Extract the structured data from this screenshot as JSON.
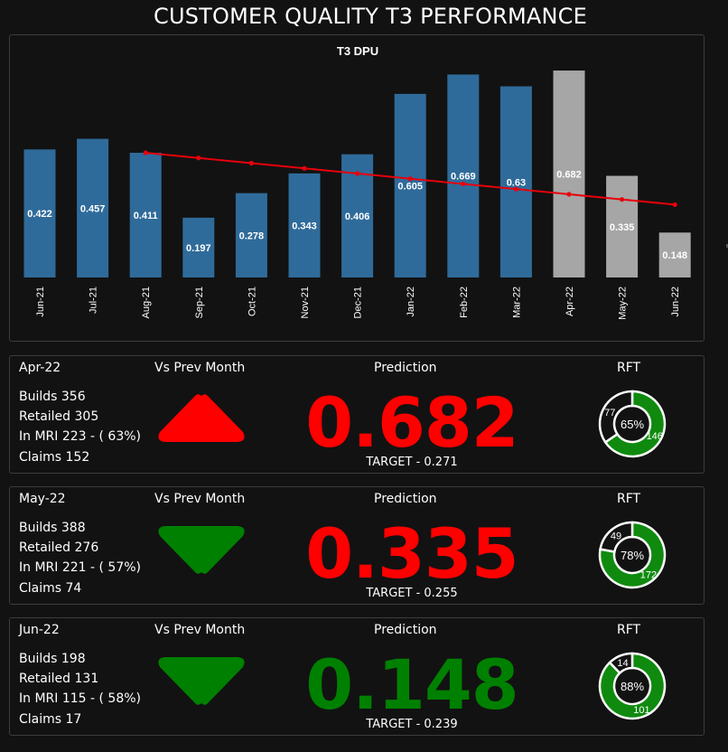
{
  "page": {
    "title": "CUSTOMER QUALITY T3 PERFORMANCE"
  },
  "chart_data": {
    "type": "bar",
    "title": "T3 DPU",
    "categories": [
      "Jun-21",
      "Jul-21",
      "Aug-21",
      "Sep-21",
      "Oct-21",
      "Nov-21",
      "Dec-21",
      "Jan-22",
      "Feb-22",
      "Mar-22",
      "Apr-22",
      "May-22",
      "Jun-22"
    ],
    "values": [
      0.422,
      0.457,
      0.411,
      0.197,
      0.278,
      0.343,
      0.406,
      0.605,
      0.669,
      0.63,
      0.682,
      0.335,
      0.148
    ],
    "value_labels": [
      "0.422",
      "0.457",
      "0.411",
      "0.197",
      "0.278",
      "0.343",
      "0.406",
      "0.605",
      "0.669",
      "0.63",
      "0.682",
      "0.335",
      "0.148"
    ],
    "bar_colors": [
      "#2f6b9a",
      "#2f6b9a",
      "#2f6b9a",
      "#2f6b9a",
      "#2f6b9a",
      "#2f6b9a",
      "#2f6b9a",
      "#2f6b9a",
      "#2f6b9a",
      "#2f6b9a",
      "#a6a6a6",
      "#a6a6a6",
      "#a6a6a6"
    ],
    "trendline": {
      "color": "#e8000b",
      "start_index": 2,
      "end_index": 12,
      "start_value": 0.411,
      "end_value": 0.24
    },
    "ylim": [
      0,
      0.7
    ],
    "xlabel": "",
    "ylabel": "",
    "grid": false,
    "legend": "none"
  },
  "cards": [
    {
      "month": "Apr-22",
      "vs_label": "Vs Prev Month",
      "prediction_label": "Prediction",
      "rft_label": "RFT",
      "builds": "Builds 356",
      "retailed": "Retailed 305",
      "in_mri": "In MRI 223 - ( 63%)",
      "claims": "Claims 152",
      "prediction": "0.682",
      "prediction_color": "#ff0000",
      "target": "TARGET - 0.271",
      "arrow": "up",
      "arrow_color": "#ff0000",
      "rft": {
        "percent_label": "65%",
        "pass": 146,
        "fail": 77,
        "pass_label": "146",
        "fail_label": "77"
      }
    },
    {
      "month": "May-22",
      "vs_label": "Vs Prev Month",
      "prediction_label": "Prediction",
      "rft_label": "RFT",
      "builds": "Builds 388",
      "retailed": "Retailed 276",
      "in_mri": "In MRI 221 - ( 57%)",
      "claims": "Claims 74",
      "prediction": "0.335",
      "prediction_color": "#ff0000",
      "target": "TARGET - 0.255",
      "arrow": "down",
      "arrow_color": "#008000",
      "rft": {
        "percent_label": "78%",
        "pass": 172,
        "fail": 49,
        "pass_label": "172",
        "fail_label": "49"
      }
    },
    {
      "month": "Jun-22",
      "vs_label": "Vs Prev Month",
      "prediction_label": "Prediction",
      "rft_label": "RFT",
      "builds": "Builds 198",
      "retailed": "Retailed 131",
      "in_mri": "In MRI 115 - ( 58%)",
      "claims": "Claims 17",
      "prediction": "0.148",
      "prediction_color": "#008000",
      "target": "TARGET - 0.239",
      "arrow": "down",
      "arrow_color": "#008000",
      "rft": {
        "percent_label": "88%",
        "pass": 101,
        "fail": 14,
        "pass_label": "101",
        "fail_label": "14"
      }
    }
  ],
  "colors": {
    "donut_pass": "#0f8a0f",
    "donut_fail": "#121212",
    "donut_stroke": "#ffffff"
  }
}
